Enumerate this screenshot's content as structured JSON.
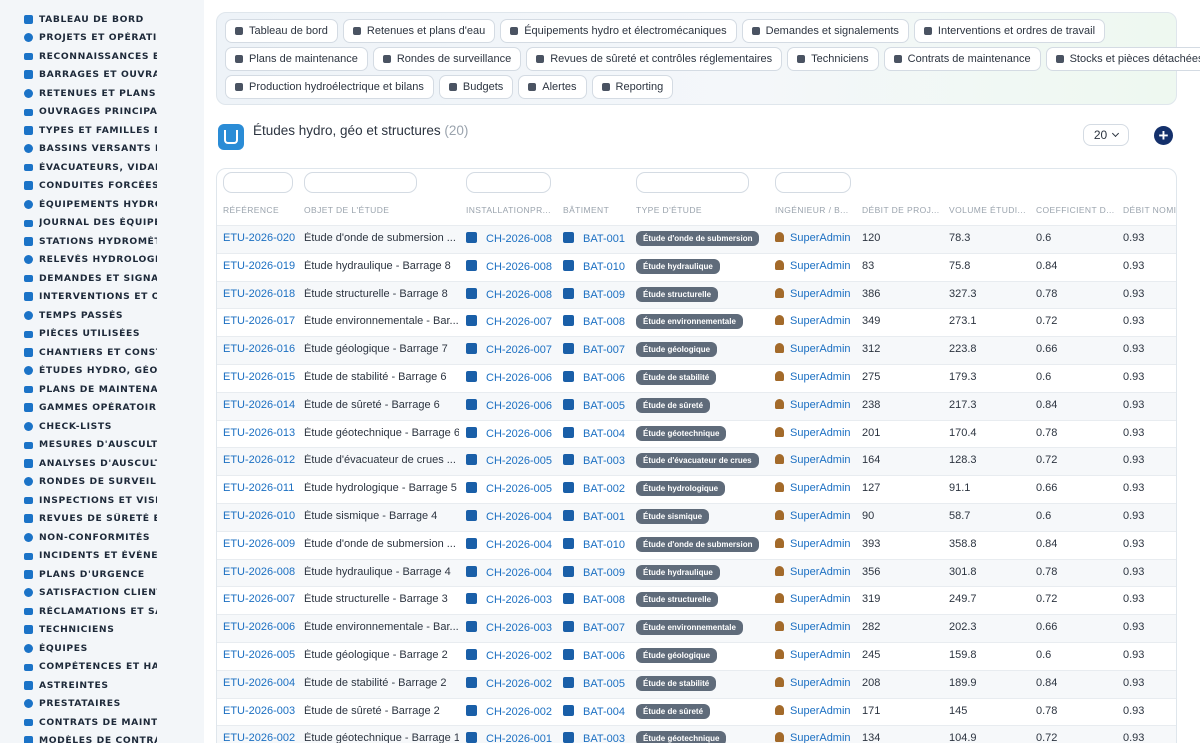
{
  "sidebar": {
    "items": [
      {
        "label": "TABLEAU DE BORD",
        "icon": "dashboard-icon"
      },
      {
        "label": "PROJETS ET OPÉRATION",
        "icon": "target-icon"
      },
      {
        "label": "RECONNAISSANCES ET V",
        "icon": "ruler-icon"
      },
      {
        "label": "BARRAGES ET OUVRAGE",
        "icon": "map-icon"
      },
      {
        "label": "RETENUES ET PLANS D'E",
        "icon": "building-icon"
      },
      {
        "label": "OUVRAGES PRINCIPAUX",
        "icon": "cube-icon"
      },
      {
        "label": "TYPES ET FAMILLES D'OU",
        "icon": "hierarchy-icon"
      },
      {
        "label": "BASSINS VERSANTS ET A",
        "icon": "grid-icon"
      },
      {
        "label": "ÉVACUATEURS, VIDANGE",
        "icon": "water-icon"
      },
      {
        "label": "CONDUITES FORCÉES ET",
        "icon": "pipe-icon"
      },
      {
        "label": "ÉQUIPEMENTS HYDRO ET",
        "icon": "cogs-icon"
      },
      {
        "label": "JOURNAL DES ÉQUIPEME",
        "icon": "history-icon"
      },
      {
        "label": "STATIONS HYDROMÉTRIC",
        "icon": "broadcast-icon"
      },
      {
        "label": "RELEVÉS HYDROLOGIQU",
        "icon": "clipboard-icon"
      },
      {
        "label": "DEMANDES ET SIGNALEM",
        "icon": "question-icon"
      },
      {
        "label": "INTERVENTIONS ET ORDI",
        "icon": "tasks-icon"
      },
      {
        "label": "TEMPS PASSÉS",
        "icon": "clock-icon"
      },
      {
        "label": "PIÈCES UTILISÉES",
        "icon": "box-icon"
      },
      {
        "label": "CHANTIERS ET CONSTRU",
        "icon": "hammer-icon"
      },
      {
        "label": "ÉTUDES HYDRO, GÉO ET",
        "icon": "flask-icon"
      },
      {
        "label": "PLANS DE MAINTENANCE",
        "icon": "calendar-icon"
      },
      {
        "label": "GAMMES OPÉRATOIRES",
        "icon": "list-icon"
      },
      {
        "label": "CHECK-LISTS",
        "icon": "checklist-icon"
      },
      {
        "label": "MESURES D'AUSCULTATI",
        "icon": "thermometer-icon"
      },
      {
        "label": "ANALYSES D'AUSCULTAT",
        "icon": "chart-icon"
      },
      {
        "label": "RONDES DE SURVEILLAN",
        "icon": "route-icon"
      },
      {
        "label": "INSPECTIONS ET VISITES",
        "icon": "search-icon"
      },
      {
        "label": "REVUES DE SÛRETÉ ET C",
        "icon": "file-check-icon"
      },
      {
        "label": "NON-CONFORMITÉS",
        "icon": "alert-icon"
      },
      {
        "label": "INCIDENTS ET ÉVÉNEMEN",
        "icon": "warning-icon"
      },
      {
        "label": "PLANS D'URGENCE",
        "icon": "document-icon"
      },
      {
        "label": "SATISFACTION CLIENT",
        "icon": "smile-icon"
      },
      {
        "label": "RÉCLAMATIONS ET SAV",
        "icon": "comment-icon"
      },
      {
        "label": "TECHNICIENS",
        "icon": "hard-hat-icon"
      },
      {
        "label": "ÉQUIPES",
        "icon": "users-icon"
      },
      {
        "label": "COMPÉTENCES ET HABIL",
        "icon": "badge-icon"
      },
      {
        "label": "ASTREINTES",
        "icon": "phone-icon"
      },
      {
        "label": "PRESTATAIRES",
        "icon": "handshake-icon"
      },
      {
        "label": "CONTRATS DE MAINTENA",
        "icon": "contract-icon"
      },
      {
        "label": "MODÈLES DE CONTRATS",
        "icon": "template-icon"
      }
    ]
  },
  "topnav": {
    "row1": [
      {
        "label": "Tableau de bord",
        "icon": "dashboard-icon"
      },
      {
        "label": "Retenues et plans d'eau",
        "icon": "building-icon"
      },
      {
        "label": "Équipements hydro et électromécaniques",
        "icon": "cogs-icon"
      },
      {
        "label": "Demandes et signalements",
        "icon": "question-icon"
      },
      {
        "label": "Interventions et ordres de travail",
        "icon": "tasks-icon"
      }
    ],
    "row2": [
      {
        "label": "Plans de maintenance",
        "icon": "calendar-icon"
      },
      {
        "label": "Rondes de surveillance",
        "icon": "route-icon"
      },
      {
        "label": "Revues de sûreté et contrôles réglementaires",
        "icon": "file-check-icon"
      },
      {
        "label": "Techniciens",
        "icon": "hard-hat-icon"
      },
      {
        "label": "Contrats de maintenance",
        "icon": "contract-icon"
      },
      {
        "label": "Stocks et pièces détachées",
        "icon": "boxes-icon"
      }
    ],
    "row3": [
      {
        "label": "Production hydroélectrique et bilans",
        "icon": "bolt-icon"
      },
      {
        "label": "Budgets",
        "icon": "money-icon"
      },
      {
        "label": "Alertes",
        "icon": "bell-icon"
      },
      {
        "label": "Reporting",
        "icon": "pie-chart-icon"
      }
    ]
  },
  "header": {
    "title": "Études hydro, géo et structures",
    "count": "(20)",
    "page_size": "20",
    "add_label": "+"
  },
  "table": {
    "columns": [
      "RÉFÉRENCE",
      "OBJET DE L'ÉTUDE",
      "INSTALLATIONPR...",
      "BÂTIMENT",
      "TYPE D'ÉTUDE",
      "INGÉNIEUR / B...",
      "DÉBIT DE PROJ...",
      "VOLUME ÉTUDI...",
      "COEFFICIENT D...",
      "DÉBIT NOMIN"
    ],
    "rows": [
      {
        "ref": "ETU-2026-020",
        "objet": "Étude d'onde de submersion ...",
        "installation": "CH-2026-008",
        "batiment": "BAT-001",
        "type": "Étude d'onde de submersion",
        "ingenieur": "SuperAdmin",
        "debit_projet": "120",
        "volume": "78.3",
        "coef": "0.6",
        "debit_nominal": "0.93"
      },
      {
        "ref": "ETU-2026-019",
        "objet": "Étude hydraulique - Barrage 8",
        "installation": "CH-2026-008",
        "batiment": "BAT-010",
        "type": "Étude hydraulique",
        "ingenieur": "SuperAdmin",
        "debit_projet": "83",
        "volume": "75.8",
        "coef": "0.84",
        "debit_nominal": "0.93"
      },
      {
        "ref": "ETU-2026-018",
        "objet": "Étude structurelle - Barrage 8",
        "installation": "CH-2026-008",
        "batiment": "BAT-009",
        "type": "Étude structurelle",
        "ingenieur": "SuperAdmin",
        "debit_projet": "386",
        "volume": "327.3",
        "coef": "0.78",
        "debit_nominal": "0.93"
      },
      {
        "ref": "ETU-2026-017",
        "objet": "Étude environnementale - Bar...",
        "installation": "CH-2026-007",
        "batiment": "BAT-008",
        "type": "Étude environnementale",
        "ingenieur": "SuperAdmin",
        "debit_projet": "349",
        "volume": "273.1",
        "coef": "0.72",
        "debit_nominal": "0.93"
      },
      {
        "ref": "ETU-2026-016",
        "objet": "Étude géologique - Barrage 7",
        "installation": "CH-2026-007",
        "batiment": "BAT-007",
        "type": "Étude géologique",
        "ingenieur": "SuperAdmin",
        "debit_projet": "312",
        "volume": "223.8",
        "coef": "0.66",
        "debit_nominal": "0.93"
      },
      {
        "ref": "ETU-2026-015",
        "objet": "Étude de stabilité - Barrage 6",
        "installation": "CH-2026-006",
        "batiment": "BAT-006",
        "type": "Étude de stabilité",
        "ingenieur": "SuperAdmin",
        "debit_projet": "275",
        "volume": "179.3",
        "coef": "0.6",
        "debit_nominal": "0.93"
      },
      {
        "ref": "ETU-2026-014",
        "objet": "Étude de sûreté - Barrage 6",
        "installation": "CH-2026-006",
        "batiment": "BAT-005",
        "type": "Étude de sûreté",
        "ingenieur": "SuperAdmin",
        "debit_projet": "238",
        "volume": "217.3",
        "coef": "0.84",
        "debit_nominal": "0.93"
      },
      {
        "ref": "ETU-2026-013",
        "objet": "Étude géotechnique - Barrage 6",
        "installation": "CH-2026-006",
        "batiment": "BAT-004",
        "type": "Étude géotechnique",
        "ingenieur": "SuperAdmin",
        "debit_projet": "201",
        "volume": "170.4",
        "coef": "0.78",
        "debit_nominal": "0.93"
      },
      {
        "ref": "ETU-2026-012",
        "objet": "Étude d'évacuateur de crues ...",
        "installation": "CH-2026-005",
        "batiment": "BAT-003",
        "type": "Étude d'évacuateur de crues",
        "ingenieur": "SuperAdmin",
        "debit_projet": "164",
        "volume": "128.3",
        "coef": "0.72",
        "debit_nominal": "0.93"
      },
      {
        "ref": "ETU-2026-011",
        "objet": "Étude hydrologique - Barrage 5",
        "installation": "CH-2026-005",
        "batiment": "BAT-002",
        "type": "Étude hydrologique",
        "ingenieur": "SuperAdmin",
        "debit_projet": "127",
        "volume": "91.1",
        "coef": "0.66",
        "debit_nominal": "0.93"
      },
      {
        "ref": "ETU-2026-010",
        "objet": "Étude sismique - Barrage 4",
        "installation": "CH-2026-004",
        "batiment": "BAT-001",
        "type": "Étude sismique",
        "ingenieur": "SuperAdmin",
        "debit_projet": "90",
        "volume": "58.7",
        "coef": "0.6",
        "debit_nominal": "0.93"
      },
      {
        "ref": "ETU-2026-009",
        "objet": "Étude d'onde de submersion ...",
        "installation": "CH-2026-004",
        "batiment": "BAT-010",
        "type": "Étude d'onde de submersion",
        "ingenieur": "SuperAdmin",
        "debit_projet": "393",
        "volume": "358.8",
        "coef": "0.84",
        "debit_nominal": "0.93"
      },
      {
        "ref": "ETU-2026-008",
        "objet": "Étude hydraulique - Barrage 4",
        "installation": "CH-2026-004",
        "batiment": "BAT-009",
        "type": "Étude hydraulique",
        "ingenieur": "SuperAdmin",
        "debit_projet": "356",
        "volume": "301.8",
        "coef": "0.78",
        "debit_nominal": "0.93"
      },
      {
        "ref": "ETU-2026-007",
        "objet": "Étude structurelle - Barrage 3",
        "installation": "CH-2026-003",
        "batiment": "BAT-008",
        "type": "Étude structurelle",
        "ingenieur": "SuperAdmin",
        "debit_projet": "319",
        "volume": "249.7",
        "coef": "0.72",
        "debit_nominal": "0.93"
      },
      {
        "ref": "ETU-2026-006",
        "objet": "Étude environnementale - Bar...",
        "installation": "CH-2026-003",
        "batiment": "BAT-007",
        "type": "Étude environnementale",
        "ingenieur": "SuperAdmin",
        "debit_projet": "282",
        "volume": "202.3",
        "coef": "0.66",
        "debit_nominal": "0.93"
      },
      {
        "ref": "ETU-2026-005",
        "objet": "Étude géologique - Barrage 2",
        "installation": "CH-2026-002",
        "batiment": "BAT-006",
        "type": "Étude géologique",
        "ingenieur": "SuperAdmin",
        "debit_projet": "245",
        "volume": "159.8",
        "coef": "0.6",
        "debit_nominal": "0.93"
      },
      {
        "ref": "ETU-2026-004",
        "objet": "Étude de stabilité - Barrage 2",
        "installation": "CH-2026-002",
        "batiment": "BAT-005",
        "type": "Étude de stabilité",
        "ingenieur": "SuperAdmin",
        "debit_projet": "208",
        "volume": "189.9",
        "coef": "0.84",
        "debit_nominal": "0.93"
      },
      {
        "ref": "ETU-2026-003",
        "objet": "Étude de sûreté - Barrage 2",
        "installation": "CH-2026-002",
        "batiment": "BAT-004",
        "type": "Étude de sûreté",
        "ingenieur": "SuperAdmin",
        "debit_projet": "171",
        "volume": "145",
        "coef": "0.78",
        "debit_nominal": "0.93"
      },
      {
        "ref": "ETU-2026-002",
        "objet": "Étude géotechnique - Barrage 1",
        "installation": "CH-2026-001",
        "batiment": "BAT-003",
        "type": "Étude géotechnique",
        "ingenieur": "SuperAdmin",
        "debit_projet": "134",
        "volume": "104.9",
        "coef": "0.72",
        "debit_nominal": "0.93"
      }
    ]
  },
  "colors": {
    "accent": "#1b6fc2",
    "sidebar_bg": "#f3f6f9",
    "badge_bg": "#5f6b7a",
    "add_button": "#14306b"
  }
}
